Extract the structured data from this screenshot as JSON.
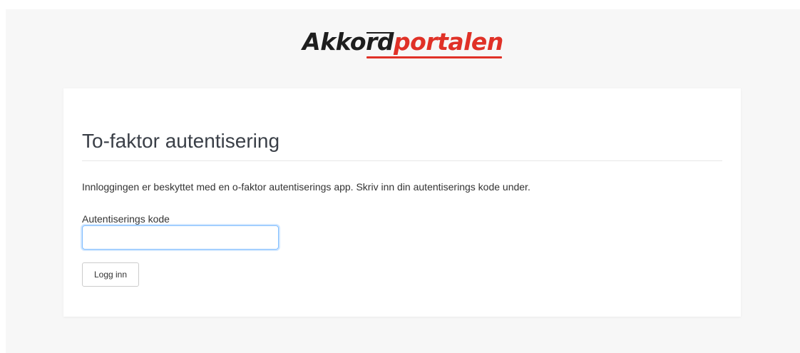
{
  "brand": {
    "logo_part1": "Akkord",
    "logo_part2": "portalen",
    "colors": {
      "dark": "#1e1e1e",
      "accent": "#e03127"
    }
  },
  "card": {
    "title": "To-faktor autentisering",
    "intro": "Innloggingen er beskyttet med en o-faktor autentiserings app. Skriv inn din autentiserings kode under.",
    "code_field": {
      "label": "Autentiserings kode",
      "value": "",
      "placeholder": ""
    },
    "login_button": "Logg inn"
  }
}
